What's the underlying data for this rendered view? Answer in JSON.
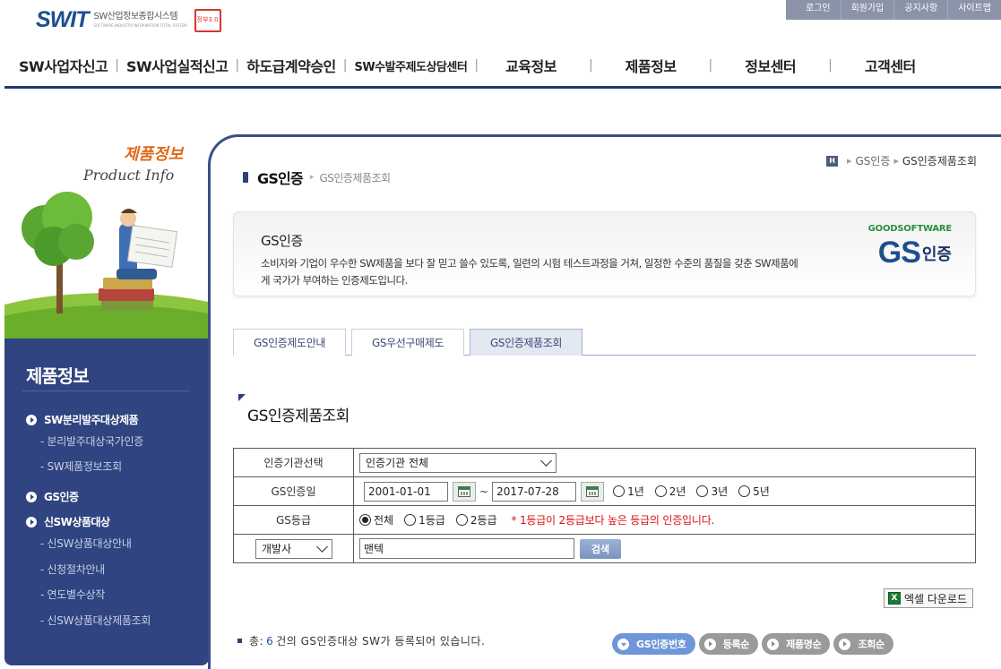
{
  "header": {
    "logo_mark": "SWIT",
    "logo_kr": "SW산업정보종합시스템",
    "logo_en": "SOFTWARE INDUSTRY INFORMATION TOTAL SYSTEM",
    "badge_text": "정부3.0"
  },
  "util_bar": [
    "로그인",
    "회원가입",
    "공지사항",
    "사이트맵"
  ],
  "gnb": [
    "SW사업자신고",
    "SW사업실적신고",
    "하도급계약승인",
    "SW수발주제도상담센터",
    "교육정보",
    "제품정보",
    "정보센터",
    "고객센터"
  ],
  "left_visual": {
    "title_kr": "제품정보",
    "title_en": "Product Info"
  },
  "lnb": {
    "title": "제품정보",
    "items": [
      {
        "label": "SW분리발주대상제품",
        "subs": [
          "분리발주대상국가인증",
          "SW제품정보조회"
        ]
      },
      {
        "label": "GS인증",
        "subs": []
      },
      {
        "label": "신SW상품대상",
        "subs": [
          "신SW상품대상안내",
          "신청절차안내",
          "연도별수상작",
          "신SW상품대상제품조회"
        ]
      }
    ]
  },
  "page": {
    "title": "GS인증",
    "sub": "GS인증제품조회",
    "breadcrumb": {
      "home": "H",
      "level1": "GS인증",
      "current": "GS인증제품조회"
    }
  },
  "intro": {
    "title": "GS인증",
    "desc": "소비자와 기업이 우수한 SW제품을 보다 잘 믿고 쓸수 있도록, 일련의 시험 테스트과정을 거쳐, 일정한 수준의 품질을 갖춘 SW제품에게 국가가 부여하는 인증제도입니다.",
    "logo_top": "GOODSOFTWARE",
    "logo_gs": "GS",
    "logo_kr": "인증"
  },
  "tabs": [
    "GS인증제도안내",
    "GS우선구매제도",
    "GS인증제품조회"
  ],
  "section_title": "GS인증제품조회",
  "search": {
    "org_label": "인증기관선택",
    "org_value": "인증기관 전체",
    "date_label": "GS인증일",
    "date_from": "2001-01-01",
    "date_tilde": "~",
    "date_to": "2017-07-28",
    "period_options": [
      "1년",
      "2년",
      "3년",
      "5년"
    ],
    "grade_label": "GS등급",
    "grade_options": [
      "전체",
      "1등급",
      "2등급"
    ],
    "grade_note": "* 1등급이 2등급보다 높은 등급의 인증입니다.",
    "kw_select": "개발사",
    "kw_value": "맨텍",
    "search_btn": "검색"
  },
  "excel_btn": "엑셀 다운로드",
  "excel_icon": "X",
  "total": {
    "prefix": "총:",
    "count": "6",
    "suffix": "건의 GS인증대상 SW가 등록되어 있습니다."
  },
  "sort_buttons": [
    "GS인증번호",
    "등록순",
    "제품명순",
    "조회순"
  ]
}
